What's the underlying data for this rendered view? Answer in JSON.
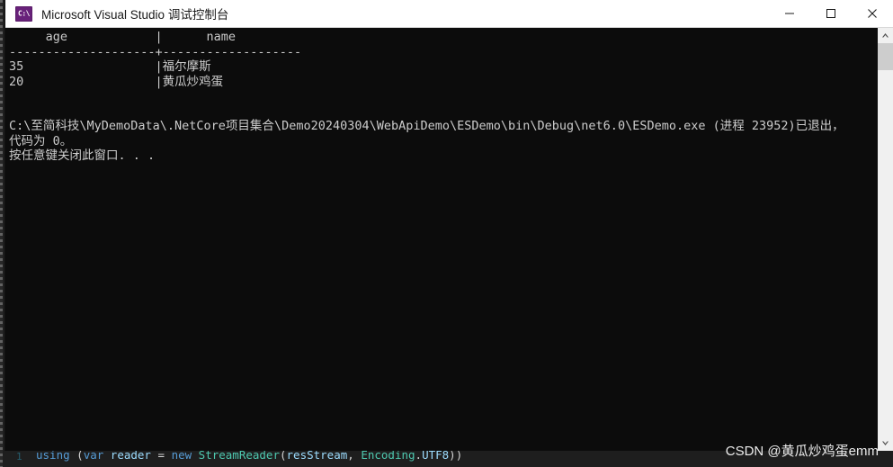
{
  "window": {
    "title": "Microsoft Visual Studio 调试控制台",
    "icon": "console-app-icon",
    "icon_glyph": "C:\\",
    "controls": {
      "minimize": "minimize-icon",
      "maximize": "maximize-icon",
      "close": "close-icon"
    }
  },
  "console": {
    "background_color": "#0c0c0c",
    "text_color": "#cccccc",
    "lines": [
      "     age            |      name",
      "--------------------+-------------------",
      "35                  |福尔摩斯",
      "20                  |黄瓜炒鸡蛋",
      "",
      "",
      "C:\\至简科技\\MyDemoData\\.NetCore项目集合\\Demo20240304\\WebApiDemo\\ESDemo\\bin\\Debug\\net6.0\\ESDemo.exe (进程 23952)已退出，",
      "代码为 0。",
      "按任意键关闭此窗口. . ."
    ],
    "table": {
      "columns": [
        "age",
        "name"
      ],
      "rows": [
        {
          "age": "35",
          "name": "福尔摩斯"
        },
        {
          "age": "20",
          "name": "黄瓜炒鸡蛋"
        }
      ]
    },
    "exit_message": {
      "executable_path": "C:\\至简科技\\MyDemoData\\.NetCore项目集合\\Demo20240304\\WebApiDemo\\ESDemo\\bin\\Debug\\net6.0\\ESDemo.exe",
      "process_id": "23952",
      "exit_code": "0",
      "press_any_key": "按任意键关闭此窗口. . ."
    }
  },
  "scrollbar": {
    "up_arrow": "chevron-up-icon",
    "down_arrow": "chevron-down-icon",
    "thumb": "scrollbar-thumb"
  },
  "editor_backdrop": {
    "line_number": "1",
    "code_tokens": {
      "kw_using": "using",
      "punc_open": " (",
      "kw_var": "var",
      "id_reader": " reader ",
      "punc_eq": "= ",
      "kw_new": "new ",
      "type_streamreader": "StreamReader",
      "punc_paren": "(",
      "id_resstream": "resStream",
      "punc_comma": ", ",
      "type_encoding": "Encoding",
      "punc_dot": ".",
      "id_utf8": "UTF8",
      "punc_close": "))"
    },
    "code_line_full": "using (var reader = new StreamReader(resStream, Encoding.UTF8))",
    "code_line2": "..."
  },
  "watermark": {
    "text": "CSDN @黄瓜炒鸡蛋emm"
  }
}
